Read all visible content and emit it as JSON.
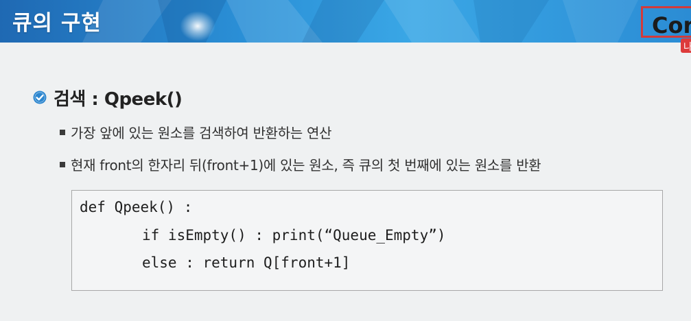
{
  "header": {
    "title": "큐의 구현",
    "corner_text": "Cor",
    "corner_tag": "나",
    "accent_color": "#2a8fd6"
  },
  "section": {
    "icon": "check-circle-icon",
    "icon_color": "#2c86cf",
    "heading": "검색 : Qpeek()"
  },
  "bullets": [
    "가장 앞에 있는 원소를 검색하여 반환하는 연산",
    "현재 front의 한자리 뒤(front+1)에 있는 원소, 즉 큐의 첫 번째에 있는 원소를 반환"
  ],
  "code": {
    "lines": [
      "def Qpeek() :",
      "if isEmpty() : print(“Queue_Empty”)",
      "else : return Q[front+1]"
    ]
  }
}
